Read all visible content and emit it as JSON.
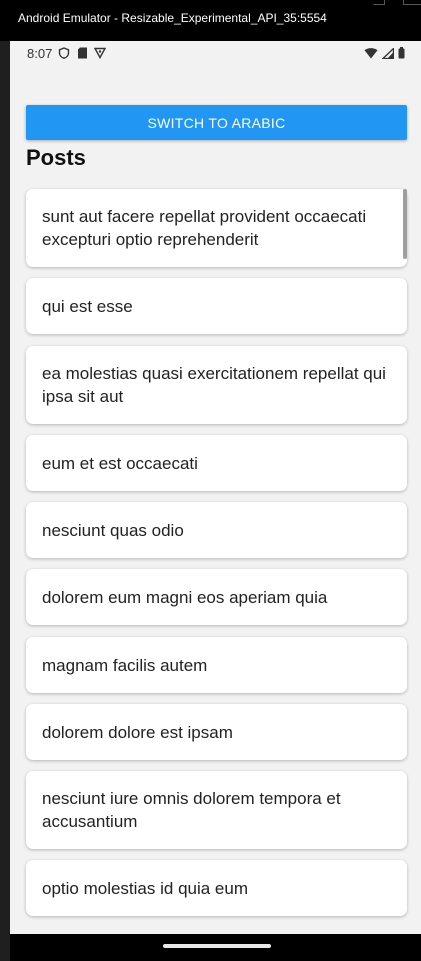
{
  "window": {
    "title": "Android Emulator - Resizable_Experimental_API_35:5554"
  },
  "status_bar": {
    "time": "8:07",
    "left_icons": [
      "shield-icon",
      "sd-card-icon",
      "vpn-icon"
    ],
    "right_icons": [
      "wifi-icon",
      "signal-icon",
      "battery-icon"
    ]
  },
  "toolbar": {
    "switch_label": "SWITCH TO ARABIC"
  },
  "page": {
    "title": "Posts"
  },
  "posts": [
    {
      "title": "sunt aut facere repellat provident occaecati excepturi optio reprehenderit"
    },
    {
      "title": "qui est esse"
    },
    {
      "title": "ea molestias quasi exercitationem repellat qui ipsa sit aut"
    },
    {
      "title": "eum et est occaecati"
    },
    {
      "title": "nesciunt quas odio"
    },
    {
      "title": "dolorem eum magni eos aperiam quia"
    },
    {
      "title": "magnam facilis autem"
    },
    {
      "title": "dolorem dolore est ipsam"
    },
    {
      "title": "nesciunt iure omnis dolorem tempora et accusantium"
    },
    {
      "title": "optio molestias id quia eum"
    }
  ],
  "colors": {
    "accent": "#2196f3",
    "background": "#f2f2f2",
    "card": "#ffffff"
  }
}
